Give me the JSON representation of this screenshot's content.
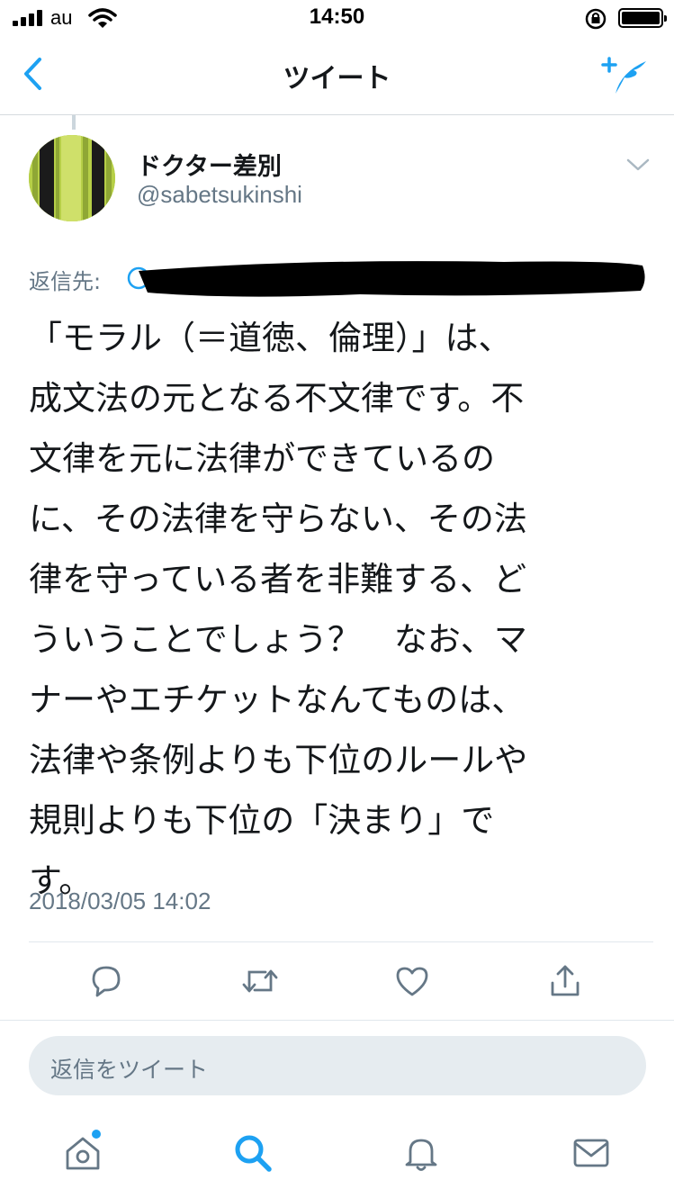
{
  "status_bar": {
    "carrier": "au",
    "time": "14:50"
  },
  "nav": {
    "title": "ツイート"
  },
  "tweet": {
    "display_name": "ドクター差別",
    "username": "@sabetsukinshi",
    "avatar_text": "ドクター差別",
    "reply_to_label": "返信先:",
    "text": "「モラル（＝道徳、倫理）」は、\n成文法の元となる不文律です。不\n文律を元に法律ができているの\nに、その法律を守らない、その法\n律を守っている者を非難する、ど\nういうことでしょう？　なお、マ\nナーやエチケットなんてものは、\n法律や条例よりも下位のルールや\n規則よりも下位の「決まり」で\nす。",
    "timestamp": "2018/03/05 14:02"
  },
  "reply_box": {
    "placeholder": "返信をツイート"
  },
  "colors": {
    "accent": "#1da1f2",
    "text": "#14171a",
    "secondary_text": "#657786",
    "divider": "#e1e8ed",
    "avatar_green": "#b6cf47"
  },
  "icons": {
    "nav": [
      "back-chevron-icon",
      "compose-tweet-icon"
    ],
    "actions": [
      "reply-icon",
      "retweet-icon",
      "like-icon",
      "share-icon"
    ],
    "tabs": [
      "home-icon",
      "search-icon",
      "notifications-icon",
      "messages-icon"
    ]
  }
}
